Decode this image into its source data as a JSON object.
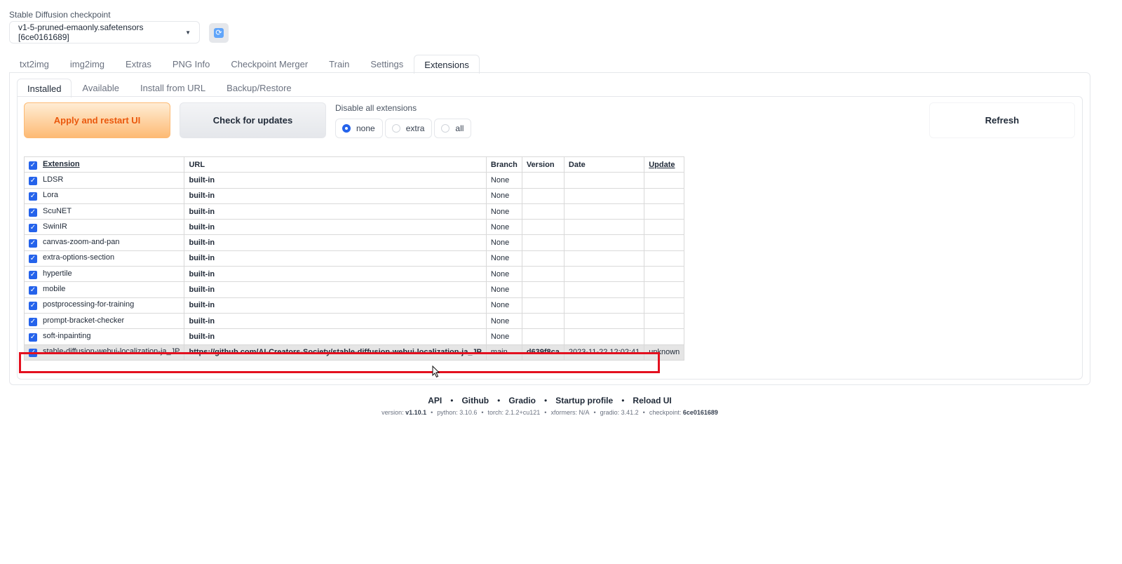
{
  "checkpoint": {
    "label": "Stable Diffusion checkpoint",
    "value": "v1-5-pruned-emaonly.safetensors [6ce0161689]",
    "refresh_icon": "refresh-icon"
  },
  "main_tabs": [
    "txt2img",
    "img2img",
    "Extras",
    "PNG Info",
    "Checkpoint Merger",
    "Train",
    "Settings",
    "Extensions"
  ],
  "main_tab_active": "Extensions",
  "sub_tabs": [
    "Installed",
    "Available",
    "Install from URL",
    "Backup/Restore"
  ],
  "sub_tab_active": "Installed",
  "actions": {
    "apply_label": "Apply and restart UI",
    "check_label": "Check for updates",
    "refresh_label": "Refresh"
  },
  "disable": {
    "label": "Disable all extensions",
    "options": [
      "none",
      "extra",
      "all"
    ],
    "selected": "none"
  },
  "table": {
    "headers": [
      "Extension",
      "URL",
      "Branch",
      "Version",
      "Date",
      "Update"
    ],
    "rows": [
      {
        "name": "LDSR",
        "url": "built-in",
        "branch": "None",
        "version": "",
        "date": "",
        "update": ""
      },
      {
        "name": "Lora",
        "url": "built-in",
        "branch": "None",
        "version": "",
        "date": "",
        "update": ""
      },
      {
        "name": "ScuNET",
        "url": "built-in",
        "branch": "None",
        "version": "",
        "date": "",
        "update": ""
      },
      {
        "name": "SwinIR",
        "url": "built-in",
        "branch": "None",
        "version": "",
        "date": "",
        "update": ""
      },
      {
        "name": "canvas-zoom-and-pan",
        "url": "built-in",
        "branch": "None",
        "version": "",
        "date": "",
        "update": ""
      },
      {
        "name": "extra-options-section",
        "url": "built-in",
        "branch": "None",
        "version": "",
        "date": "",
        "update": ""
      },
      {
        "name": "hypertile",
        "url": "built-in",
        "branch": "None",
        "version": "",
        "date": "",
        "update": ""
      },
      {
        "name": "mobile",
        "url": "built-in",
        "branch": "None",
        "version": "",
        "date": "",
        "update": ""
      },
      {
        "name": "postprocessing-for-training",
        "url": "built-in",
        "branch": "None",
        "version": "",
        "date": "",
        "update": ""
      },
      {
        "name": "prompt-bracket-checker",
        "url": "built-in",
        "branch": "None",
        "version": "",
        "date": "",
        "update": ""
      },
      {
        "name": "soft-inpainting",
        "url": "built-in",
        "branch": "None",
        "version": "",
        "date": "",
        "update": ""
      },
      {
        "name": "stable-diffusion-webui-localization-ja_JP",
        "url": "https://github.com/AI-Creators-Society/stable-diffusion-webui-localization-ja_JP",
        "branch": "main",
        "version": "d639f8ca",
        "date": "2023-11-22 12:02:41",
        "update": "unknown"
      }
    ]
  },
  "footer": {
    "links": [
      "API",
      "Github",
      "Gradio",
      "Startup profile",
      "Reload UI"
    ],
    "separator": "•",
    "version_label": "version:",
    "version": "v1.10.1",
    "python": "python: 3.10.6",
    "torch": "torch: 2.1.2+cu121",
    "xformers": "xformers: N/A",
    "gradio": "gradio: 3.41.2",
    "checkpoint_label": "checkpoint:",
    "checkpoint": "6ce0161689"
  },
  "colors": {
    "accent": "#2563eb",
    "apply_text": "#ea580c",
    "highlight_border": "#e3101f"
  }
}
